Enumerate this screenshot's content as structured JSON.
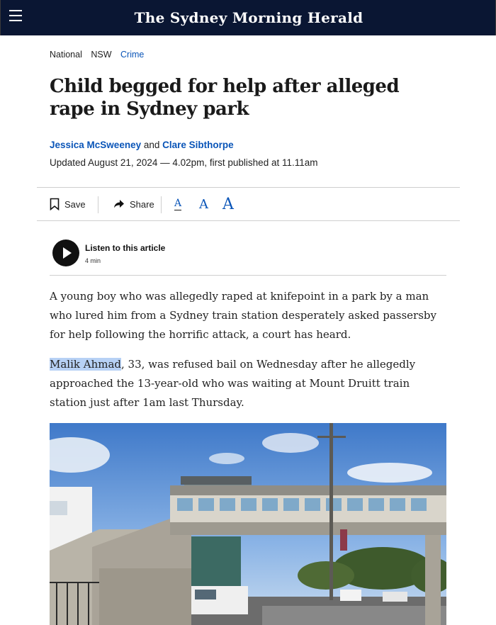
{
  "header": {
    "masthead": "The Sydney Morning Herald",
    "menu_icon": "hamburger-icon"
  },
  "breadcrumb": [
    "National",
    "NSW",
    "Crime"
  ],
  "article": {
    "headline": "Child begged for help after alleged rape in Sydney park",
    "author1": "Jessica McSweeney",
    "and": "and",
    "author2": "Clare Sibthorpe",
    "updated": "Updated August 21, 2024 — 4.02pm, first published at 11.11am",
    "p1": "A young boy who was allegedly raped at knifepoint in a park by a man who lured him from a Sydney train station desperately asked passersby for help following the horrific attack, a court has heard.",
    "p2_highlight": "Malik Ahmad",
    "p2_rest": ", 33, was refused bail on Wednesday after he allegedly approached the 13-year-old who was waiting at Mount Druitt train station just after 1am last Thursday."
  },
  "toolbar": {
    "save_label": "Save",
    "share_label": "Share",
    "font_small": "A",
    "font_medium": "A",
    "font_large": "A"
  },
  "listen": {
    "label": "Listen to this article",
    "duration": "4 min"
  },
  "colors": {
    "header_bg": "#0a1633",
    "link": "#0a55b8",
    "highlight": "#b7d1f5"
  }
}
